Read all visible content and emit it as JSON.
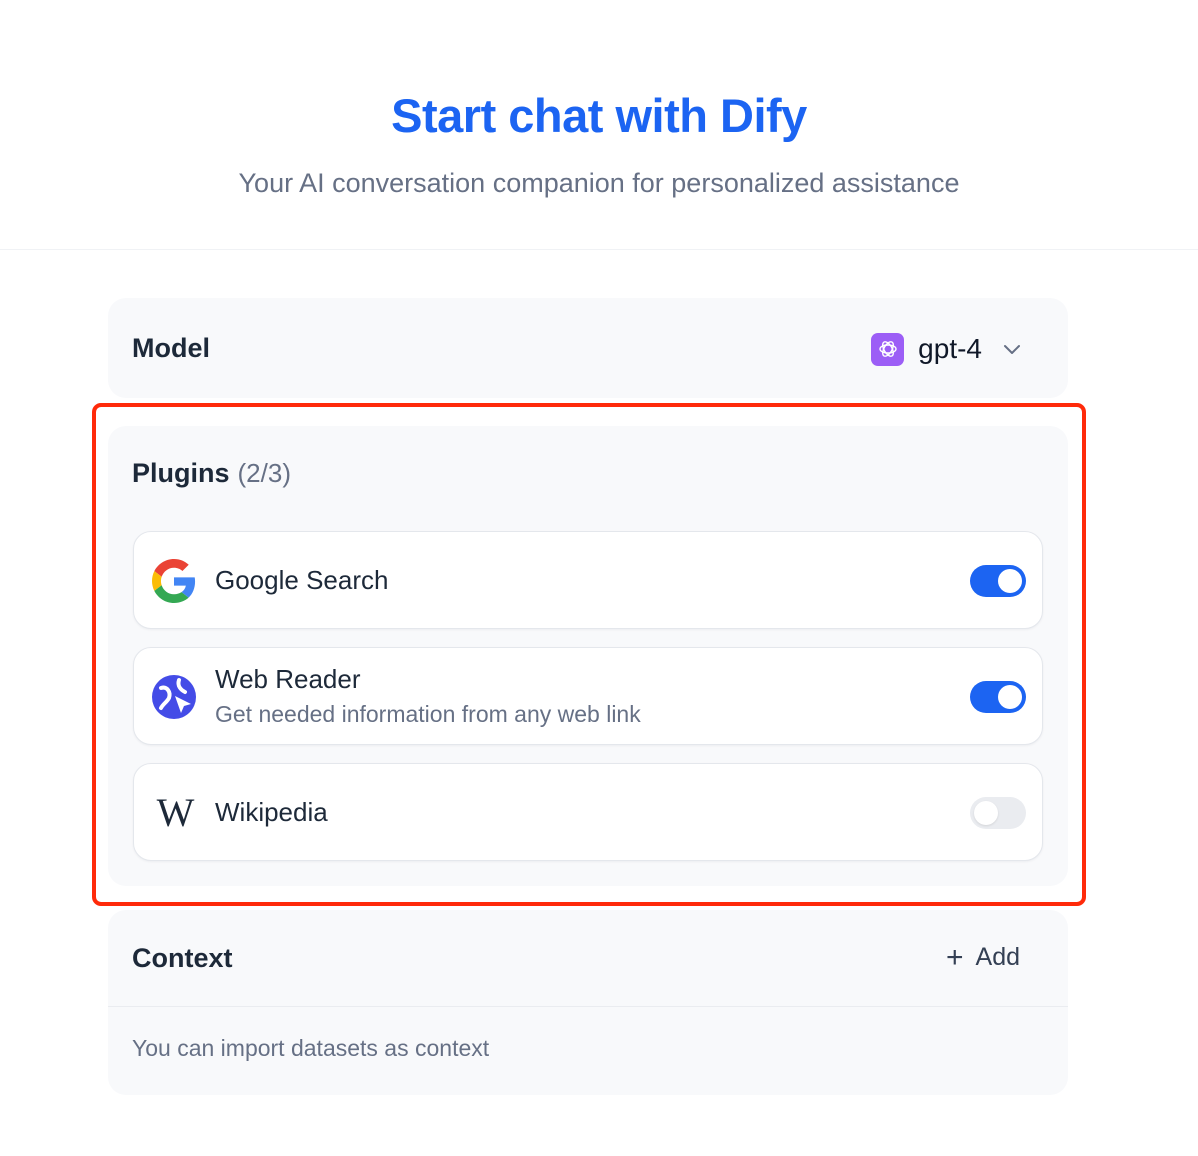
{
  "header": {
    "title": "Start chat with Dify",
    "subtitle": "Your AI conversation companion for personalized assistance"
  },
  "model": {
    "label": "Model",
    "selected": "gpt-4",
    "icon": "openai-icon"
  },
  "plugins": {
    "label": "Plugins",
    "count": "(2/3)",
    "items": [
      {
        "name": "Google Search",
        "description": "",
        "icon": "google-icon",
        "enabled": true
      },
      {
        "name": "Web Reader",
        "description": "Get needed information from any web link",
        "icon": "web-reader-icon",
        "enabled": true
      },
      {
        "name": "Wikipedia",
        "description": "",
        "icon": "wikipedia-icon",
        "icon_text": "W",
        "enabled": false
      }
    ]
  },
  "context": {
    "label": "Context",
    "add_label": "Add",
    "add_icon": "plus-icon",
    "description": "You can import datasets as context"
  },
  "colors": {
    "accent": "#1c64f2",
    "highlight": "#ff2a0a",
    "toggle_off": "#eaecf0"
  }
}
